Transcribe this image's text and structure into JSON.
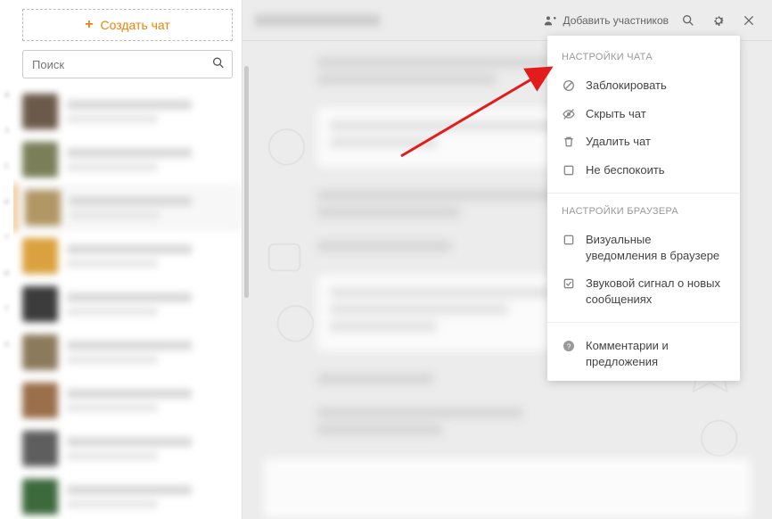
{
  "sidebar": {
    "create_chat": "Создать чат",
    "search_placeholder": "Поиск",
    "conversations": [
      {
        "color": "#6b5a4a"
      },
      {
        "color": "#7a7f59"
      },
      {
        "color": "#b29766"
      },
      {
        "color": "#d9a23f"
      },
      {
        "color": "#3c3c3c"
      },
      {
        "color": "#8c7a5c"
      },
      {
        "color": "#9a6f4a"
      },
      {
        "color": "#5e5e5e"
      },
      {
        "color": "#3d6a3d"
      }
    ],
    "selected_index": 2
  },
  "header": {
    "add_participants": "Добавить участников"
  },
  "settings_panel": {
    "section_chat": "НАСТРОЙКИ ЧАТА",
    "section_browser": "НАСТРОЙКИ БРАУЗЕРА",
    "items_chat": {
      "block": "Заблокировать",
      "hide": "Скрыть чат",
      "delete": "Удалить чат",
      "dnd": "Не беспокоить"
    },
    "items_browser": {
      "visual_notif": "Визуальные уведомления в браузере",
      "sound_notif": "Звуковой сигнал о новых сообщениях"
    },
    "feedback": "Комментарии и предложения"
  },
  "colors": {
    "accent": "#ee8208"
  }
}
